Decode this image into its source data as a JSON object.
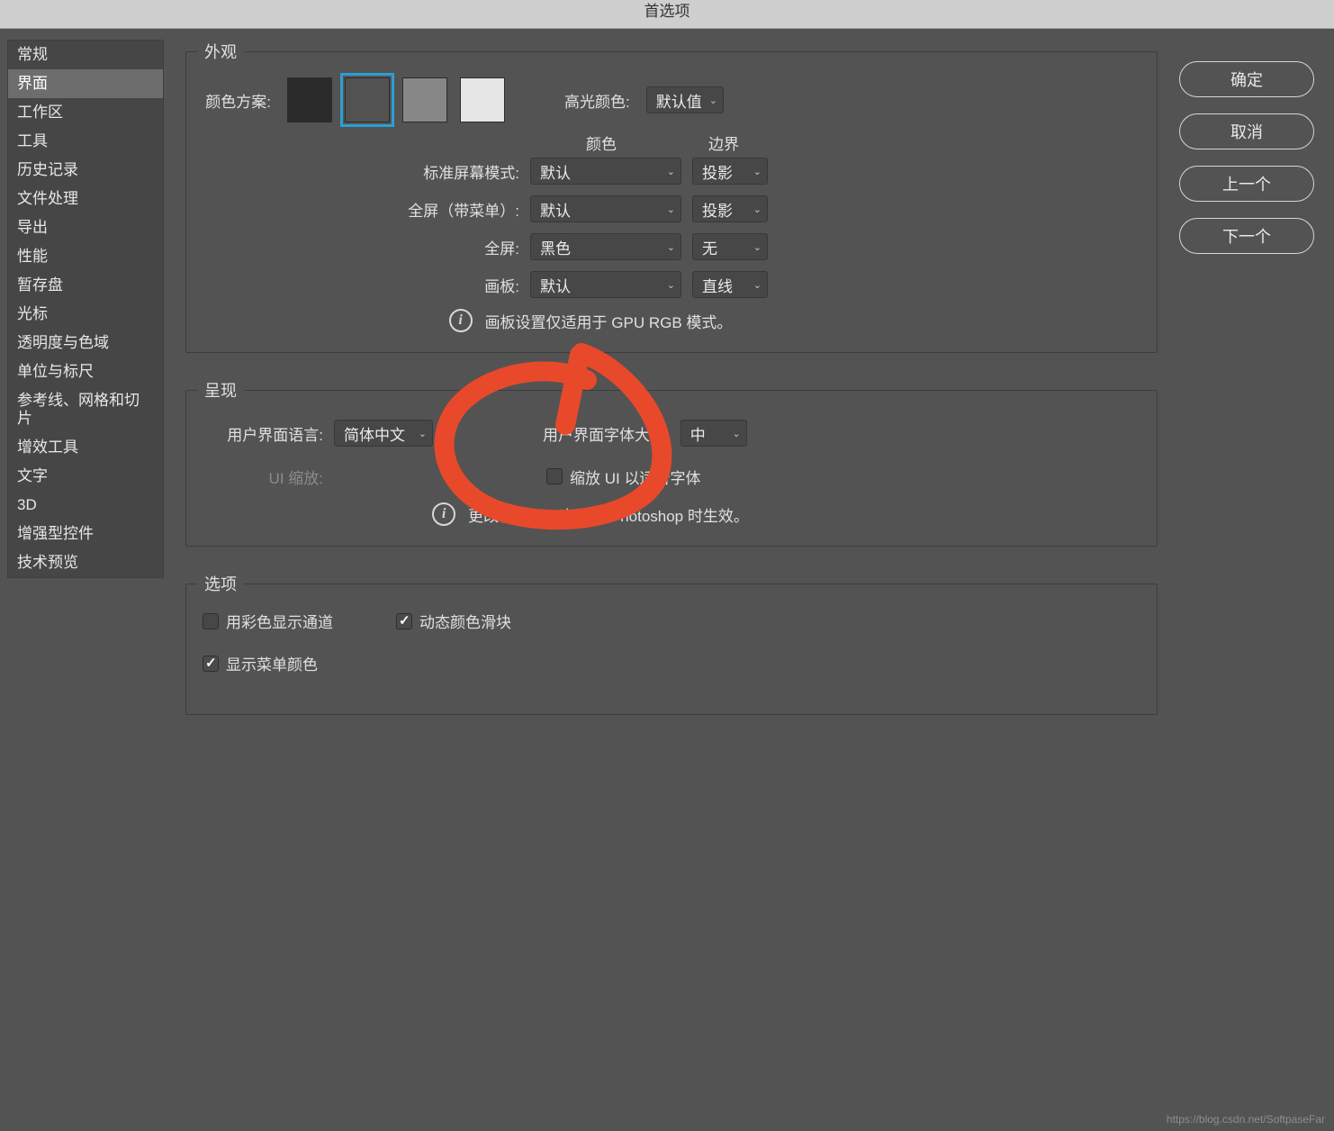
{
  "title": "首选项",
  "sidebar": {
    "items": [
      {
        "label": "常规"
      },
      {
        "label": "界面"
      },
      {
        "label": "工作区"
      },
      {
        "label": "工具"
      },
      {
        "label": "历史记录"
      },
      {
        "label": "文件处理"
      },
      {
        "label": "导出"
      },
      {
        "label": "性能"
      },
      {
        "label": "暂存盘"
      },
      {
        "label": "光标"
      },
      {
        "label": "透明度与色域"
      },
      {
        "label": "单位与标尺"
      },
      {
        "label": "参考线、网格和切片"
      },
      {
        "label": "增效工具"
      },
      {
        "label": "文字"
      },
      {
        "label": "3D"
      },
      {
        "label": "增强型控件"
      },
      {
        "label": "技术预览"
      }
    ],
    "selected_index": 1
  },
  "buttons": {
    "ok": "确定",
    "cancel": "取消",
    "prev": "上一个",
    "next": "下一个"
  },
  "appearance": {
    "legend": "外观",
    "color_scheme_label": "颜色方案:",
    "swatches": [
      "#2b2b2b",
      "#525252",
      "#878787",
      "#e6e6e6"
    ],
    "swatch_selected": 1,
    "highlight_label": "高光颜色:",
    "highlight_value": "默认值",
    "header_color": "颜色",
    "header_border": "边界",
    "rows": [
      {
        "label": "标准屏幕模式:",
        "color": "默认",
        "border": "投影"
      },
      {
        "label": "全屏（带菜单）:",
        "color": "默认",
        "border": "投影"
      },
      {
        "label": "全屏:",
        "color": "黑色",
        "border": "无"
      },
      {
        "label": "画板:",
        "color": "默认",
        "border": "直线"
      }
    ],
    "note": "画板设置仅适用于 GPU RGB 模式。"
  },
  "presentation": {
    "legend": "呈现",
    "lang_label": "用户界面语言:",
    "lang_value": "简体中文",
    "font_size_label": "用户界面字体大小:",
    "font_size_value": "中",
    "ui_scale_label": "UI 缩放:",
    "scale_ui_checkbox": "缩放 UI 以适合字体",
    "scale_ui_checked": false,
    "note": "更改将在下一次启动 Photoshop 时生效。"
  },
  "options": {
    "legend": "选项",
    "color_channels": {
      "label": "用彩色显示通道",
      "checked": false
    },
    "dynamic_sliders": {
      "label": "动态颜色滑块",
      "checked": true
    },
    "menu_colors": {
      "label": "显示菜单颜色",
      "checked": true
    }
  },
  "watermark": "https://blog.csdn.net/SoftpaseFar"
}
